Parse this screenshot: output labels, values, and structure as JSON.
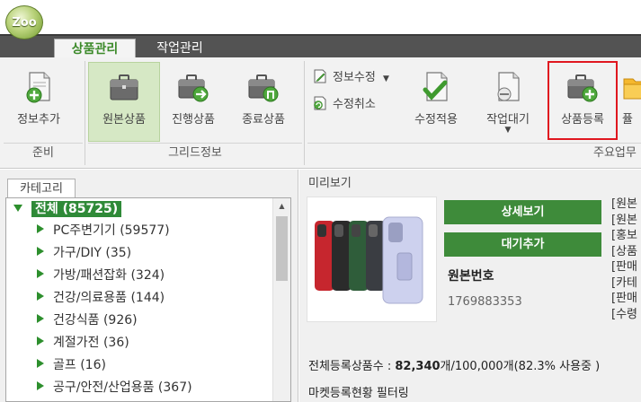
{
  "app": {
    "logo_text": "Zoo"
  },
  "tabs": [
    {
      "label": "상품관리",
      "active": true
    },
    {
      "label": "작업관리",
      "active": false
    }
  ],
  "ribbon": {
    "groups": [
      {
        "label": "준비"
      },
      {
        "label": "그리드정보"
      },
      {
        "label": "주요업무"
      }
    ],
    "buttons": {
      "info_add": "정보추가",
      "original_product": "원본상품",
      "in_progress_product": "진행상품",
      "ended_product": "종료상품",
      "info_edit": "정보수정",
      "cancel_edit": "수정취소",
      "apply_edit": "수정적용",
      "job_wait": "작업대기",
      "product_register": "상품등록",
      "cut_off": "퓰"
    }
  },
  "category": {
    "tab_label": "카테고리",
    "root": "전체 (85725)",
    "items": [
      "PC주변기기 (59577)",
      "가구/DIY (35)",
      "가방/패션잡화 (324)",
      "건강/의료용품 (144)",
      "건강식품 (926)",
      "계절가전 (36)",
      "골프 (16)",
      "공구/안전/산업용품 (367)"
    ]
  },
  "preview": {
    "title": "미리보기",
    "detail_button": "상세보기",
    "wait_add_button": "대기추가",
    "original_number_label": "원본번호",
    "original_number_value": "1769883353",
    "side_labels": [
      "[원본",
      "[원본",
      "[홍보",
      "[상품",
      "[판매",
      "[카테",
      "[판매",
      "[수령"
    ],
    "summary_prefix": "전체등록상품수 : ",
    "summary_count": "82,340",
    "summary_rest": "개/100,000개(82.3% 사용중 )",
    "filter_label": "마켓등록현황 필터링"
  },
  "colors": {
    "accent_green": "#3e8b3a",
    "tab_bar": "#535353",
    "highlight_red": "#e0171f",
    "selected_bg": "#d6e8c5"
  }
}
